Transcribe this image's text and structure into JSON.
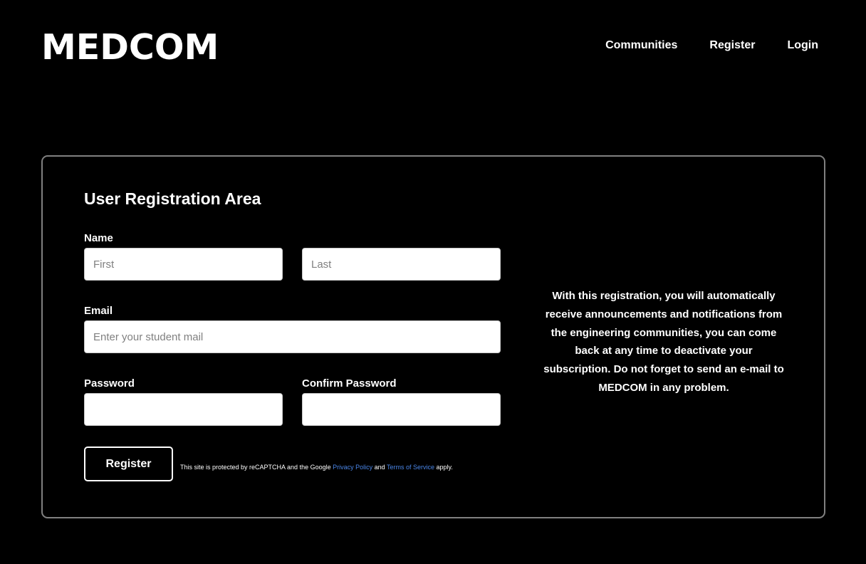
{
  "header": {
    "logo": "MEDCOM",
    "nav": [
      {
        "label": "Communities"
      },
      {
        "label": "Register"
      },
      {
        "label": "Login"
      }
    ]
  },
  "form": {
    "title": "User Registration Area",
    "name_label": "Name",
    "first_placeholder": "First",
    "last_placeholder": "Last",
    "email_label": "Email",
    "email_placeholder": "Enter your student mail",
    "password_label": "Password",
    "confirm_label": "Confirm Password",
    "submit_label": "Register",
    "recaptcha": {
      "prefix": "This site is protected by reCAPTCHA and the Google ",
      "privacy_link": "Privacy Policy",
      "middle": " and ",
      "terms_link": "Terms of Service",
      "suffix": " apply."
    }
  },
  "info_text": "With this registration, you will automatically receive announcements and notifications from the engineering communities, you can come back at any time to deactivate your subscription. Do not forget to send an e-mail to MEDCOM in any problem.",
  "colors": {
    "background": "#000000",
    "text": "#ffffff",
    "panel_border": "#808080",
    "link": "#4a86e8"
  }
}
